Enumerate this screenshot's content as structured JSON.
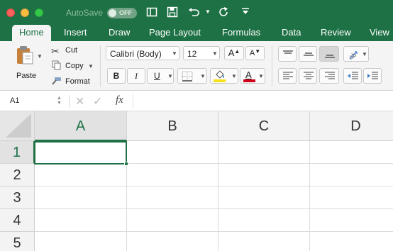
{
  "titlebar": {
    "autosave_label": "AutoSave",
    "autosave_state": "OFF"
  },
  "tabs": [
    {
      "label": "Home",
      "active": true
    },
    {
      "label": "Insert",
      "active": false
    },
    {
      "label": "Draw",
      "active": false
    },
    {
      "label": "Page Layout",
      "active": false
    },
    {
      "label": "Formulas",
      "active": false
    },
    {
      "label": "Data",
      "active": false
    },
    {
      "label": "Review",
      "active": false
    },
    {
      "label": "View",
      "active": false
    }
  ],
  "ribbon": {
    "paste_label": "Paste",
    "cut_label": "Cut",
    "copy_label": "Copy",
    "format_label": "Format",
    "font_name": "Calibri (Body)",
    "font_size": "12",
    "bold_label": "B",
    "italic_label": "I",
    "underline_label": "U",
    "grow_font_label": "A",
    "shrink_font_label": "A",
    "font_color_label": "A",
    "highlight_color": "#f7e11b",
    "font_color": "#d0021b"
  },
  "formula_bar": {
    "name_box": "A1",
    "fx_label": "fx",
    "value": ""
  },
  "grid": {
    "columns": [
      "A",
      "B",
      "C",
      "D"
    ],
    "rows": [
      "1",
      "2",
      "3",
      "4",
      "5"
    ],
    "selected_cell": "A1"
  },
  "colors": {
    "accent": "#1e7145",
    "ribbon_bg": "#f4f4f4"
  }
}
